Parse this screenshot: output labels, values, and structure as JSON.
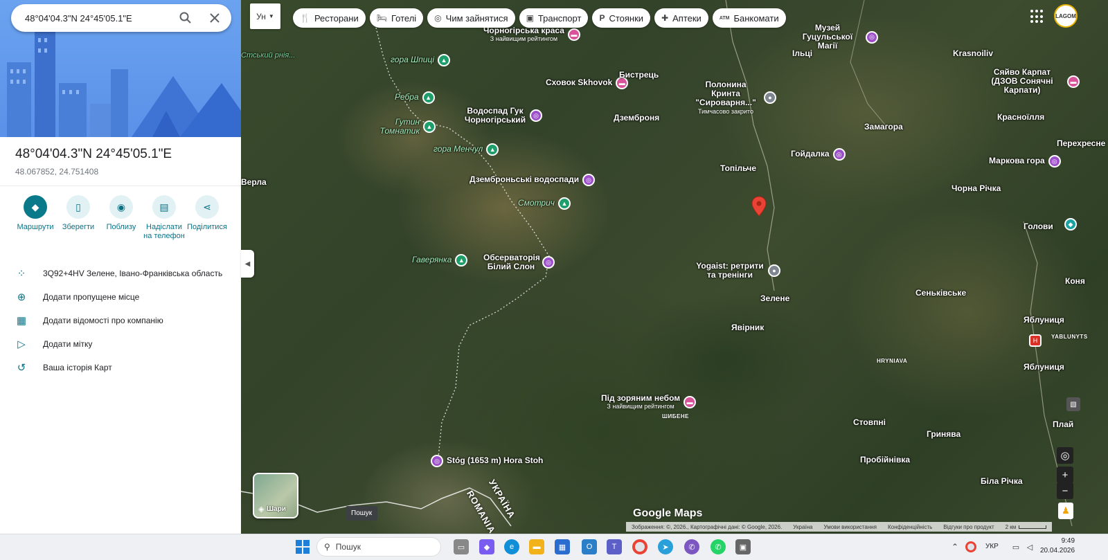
{
  "search": {
    "value": "48°04'04.3\"N 24°45'05.1\"E"
  },
  "place": {
    "title": "48°04'04.3\"N 24°45'05.1\"E",
    "decimal": "48.067852, 24.751408"
  },
  "actions": [
    {
      "label": "Маршрути",
      "icon": "directions-icon"
    },
    {
      "label": "Зберегти",
      "icon": "bookmark-icon"
    },
    {
      "label": "Поблизу",
      "icon": "nearby-icon"
    },
    {
      "label": "Надіслати на телефон",
      "icon": "send-to-phone-icon"
    },
    {
      "label": "Поділитися",
      "icon": "share-icon"
    }
  ],
  "info": [
    {
      "text": "3Q92+4HV Зелене, Івано-Франківська область",
      "icon": "plus-code-icon"
    },
    {
      "text": "Додати пропущене місце",
      "icon": "add-place-icon"
    },
    {
      "text": "Додати відомості про компанію",
      "icon": "add-business-icon"
    },
    {
      "text": "Додати мітку",
      "icon": "label-icon"
    },
    {
      "text": "Ваша історія Карт",
      "icon": "history-icon"
    }
  ],
  "lang_toggle": "Ун",
  "chips": [
    {
      "label": "Ресторани",
      "icon": "restaurant-icon",
      "glyph": "🍴"
    },
    {
      "label": "Готелі",
      "icon": "hotel-icon",
      "glyph": "🛏"
    },
    {
      "label": "Чим зайнятися",
      "icon": "camera-icon",
      "glyph": "◎"
    },
    {
      "label": "Транспорт",
      "icon": "transit-icon",
      "glyph": "▣"
    },
    {
      "label": "Стоянки",
      "icon": "parking-icon",
      "glyph": "P"
    },
    {
      "label": "Аптеки",
      "icon": "pharmacy-icon",
      "glyph": "✚"
    },
    {
      "label": "Банкомати",
      "icon": "atm-icon",
      "glyph": "ATM"
    }
  ],
  "avatar_text": "LAGOM",
  "map": {
    "places": [
      {
        "name": "Чорногірська краса",
        "sub": "З найвищим рейтингом",
        "type": "pink"
      },
      {
        "name": "гора Шпиці",
        "sub": "",
        "type": "green"
      },
      {
        "name": "Ребра",
        "sub": "",
        "type": "green"
      },
      {
        "name": "Гутин Томнатик",
        "sub": "",
        "type": "green"
      },
      {
        "name": "Водоспад Гук Чорногірський",
        "sub": "",
        "type": "violet"
      },
      {
        "name": "гора Менчул",
        "sub": "",
        "type": "green"
      },
      {
        "name": "Дземброньські водоспади",
        "sub": "",
        "type": "violet"
      },
      {
        "name": "Смотрич",
        "sub": "",
        "type": "green"
      },
      {
        "name": "Гаверянка",
        "sub": "",
        "type": "green"
      },
      {
        "name": "Обсерваторія Білий Слон",
        "sub": "",
        "type": "violet"
      },
      {
        "name": "Сховок Skhovok",
        "sub": "",
        "type": "pink"
      },
      {
        "name": "Полонина Кринта \"Сироварня...\"",
        "sub": "Тимчасово закрито",
        "type": "gray"
      },
      {
        "name": "Музей Гуцульської Магії",
        "sub": "",
        "type": "violet"
      },
      {
        "name": "Гойдалка",
        "sub": "",
        "type": "violet"
      },
      {
        "name": "Сяйво Карпат (ДЗОВ Сонячні Карпати)",
        "sub": "",
        "type": "pink"
      },
      {
        "name": "Маркова гора",
        "sub": "",
        "type": "violet"
      },
      {
        "name": "Yogaist: ретрити та тренінги",
        "sub": "",
        "type": "gray"
      },
      {
        "name": "Під зоряним небом",
        "sub": "З найвищим рейтингом",
        "type": "pink"
      },
      {
        "name": "Stóg (1653 m) Hora Stoh",
        "sub": "",
        "type": "violet"
      }
    ],
    "towns": [
      "Бистрець",
      "Дземброня",
      "Топільче",
      "Зелене",
      "Явірник",
      "Ільці",
      "Krasnoiliv",
      "Замагора",
      "Красноїлля",
      "Перехресне",
      "Чорна Річка",
      "Голови",
      "Сеньківське",
      "Яблуниця",
      "Яблуниця",
      "Стовпні",
      "Гринява",
      "Пробійнівка",
      "Біла Річка",
      "Плай",
      "Коня",
      "Верла"
    ],
    "tiny_labels": [
      "HRYNIAVA",
      "ШИБЕНЕ",
      "YABLUNYTS"
    ],
    "border_labels": [
      "УКРАЇНА",
      "ROMANIA"
    ],
    "top_left_fragment": "Стський рнія..."
  },
  "layers_label": "Шари",
  "tooltip": "Пошук",
  "google_logo": "Google Maps",
  "footer": {
    "imagery": "Зображення: ©, 2026., Картографічні дані: © Google, 2026.",
    "country": "Україна",
    "terms": "Умови використання",
    "privacy": "Конфіденційність",
    "report": "Відгуки про продукт",
    "scale": "2 км"
  },
  "taskbar": {
    "search_placeholder": "Пошук",
    "lang": "УКР",
    "time": "9:49",
    "date": "20.04.2026"
  },
  "colors": {
    "accent": "#0b7285",
    "marker": "#ea4335"
  }
}
